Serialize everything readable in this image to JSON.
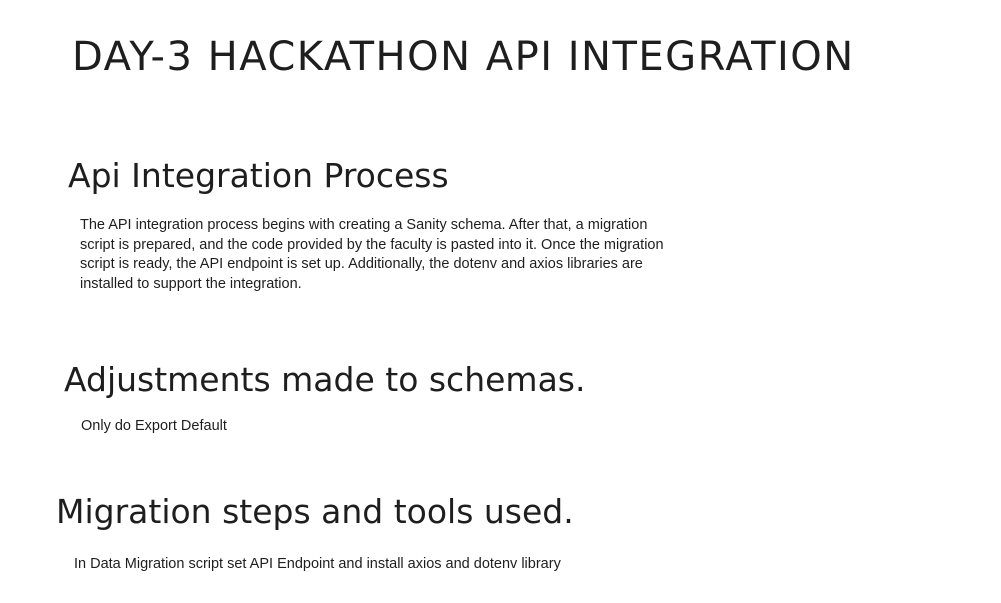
{
  "title": "DAY-3 HACKATHON API INTEGRATION",
  "sections": [
    {
      "heading": "Api Integration Process",
      "lines": [
        "The API integration process begins with creating a Sanity schema. After that, a migration",
        "script is prepared, and the code provided by the faculty is pasted into it. Once the migration",
        "script is ready, the API endpoint is set up. Additionally, the dotenv and axios libraries are",
        "installed to support the integration."
      ]
    },
    {
      "heading": "Adjustments made to schemas.",
      "lines": [
        "Only do Export Default"
      ]
    },
    {
      "heading": "Migration steps and tools used.",
      "lines": [
        "In Data Migration script set API Endpoint and install axios and dotenv library"
      ]
    }
  ]
}
